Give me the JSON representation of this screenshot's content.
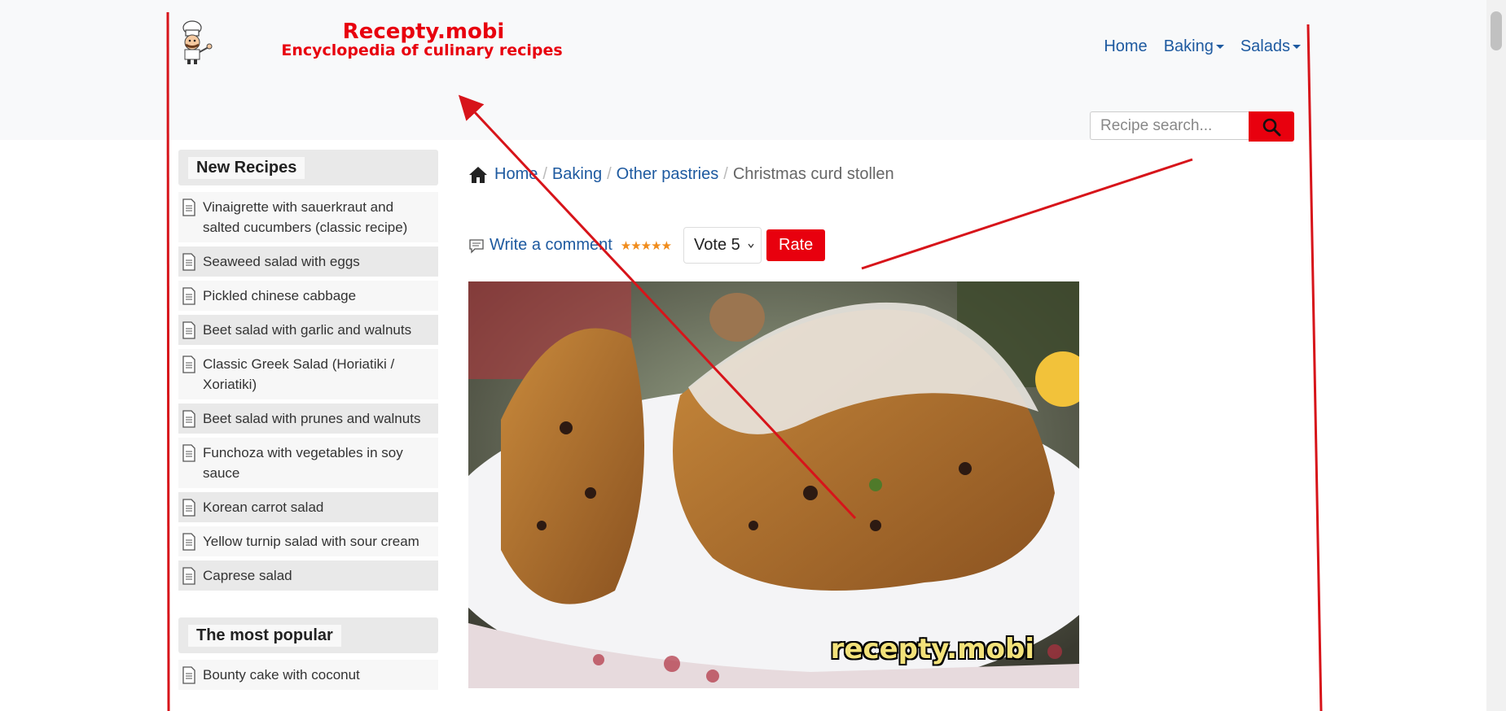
{
  "brand": {
    "title": "Recepty.mobi",
    "subtitle": "Encyclopedia of culinary recipes",
    "logo_icon": "chef-icon"
  },
  "nav": {
    "home": "Home",
    "baking": "Baking",
    "salads": "Salads"
  },
  "search": {
    "placeholder": "Recipe search...",
    "icon": "search-icon"
  },
  "sidebar": {
    "new_recipes_title": "New Recipes",
    "new_recipes": [
      "Vinaigrette with sauerkraut and salted cucumbers (classic recipe)",
      "Seaweed salad with eggs",
      "Pickled chinese cabbage",
      "Beet salad with garlic and walnuts",
      "Classic Greek Salad (Horiatiki / Xoriatiki)",
      "Beet salad with prunes and walnuts",
      "Funchoza with vegetables in soy sauce",
      "Korean carrot salad",
      "Yellow turnip salad with sour cream",
      "Caprese salad"
    ],
    "popular_title": "The most popular",
    "popular": [
      "Bounty cake with coconut"
    ]
  },
  "breadcrumb": {
    "home": "Home",
    "baking": "Baking",
    "other_pastries": "Other pastries",
    "current": "Christmas curd stollen"
  },
  "rating": {
    "comment_link": "Write a comment",
    "stars": "★★★★★",
    "vote_value": "Vote 5",
    "rate_button": "Rate"
  },
  "photo": {
    "watermark": "recepty.mobi"
  },
  "colors": {
    "accent": "#e8000e",
    "link": "#1e5aa0",
    "annotation": "#d7141a"
  }
}
